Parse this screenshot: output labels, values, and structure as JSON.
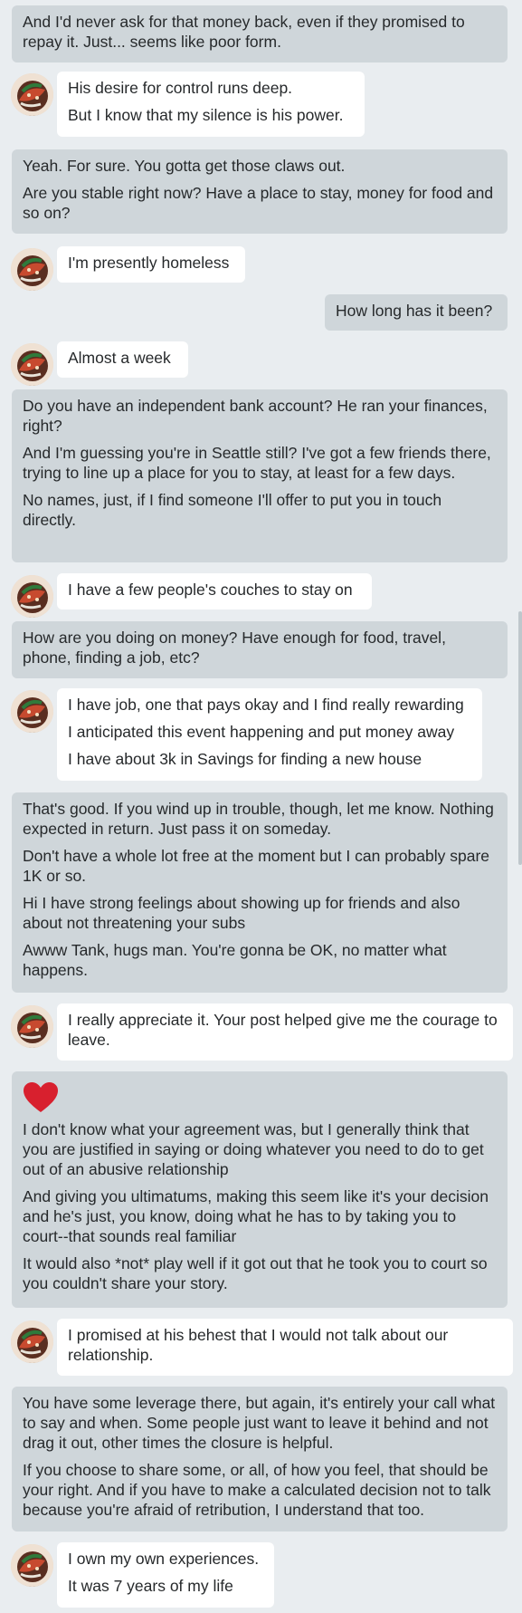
{
  "messages": [
    {
      "side": "sent",
      "lines": [
        "And I'd never ask for that money back, even if they promised to repay it. Just... seems like poor form."
      ]
    },
    {
      "side": "recv",
      "lines": [
        "His desire for control runs deep.",
        "But I know that my silence is his power."
      ]
    },
    {
      "side": "sent",
      "lines": [
        "Yeah. For sure. You gotta get those claws out.",
        "Are you stable right now? Have a place to stay, money for food and so on?"
      ]
    },
    {
      "side": "recv",
      "lines": [
        "I'm presently homeless"
      ]
    },
    {
      "side": "sent",
      "lines": [
        "How long has it been?"
      ]
    },
    {
      "side": "recv",
      "lines": [
        "Almost a week"
      ]
    },
    {
      "side": "sent",
      "lines": [
        "Do you have an independent bank account? He ran your finances, right?",
        "And I'm guessing you're in Seattle still? I've got a few friends there, trying to line up a place for you to stay, at least for a few days.",
        "No names, just, if I find someone I'll offer to put you in touch directly."
      ]
    },
    {
      "side": "recv",
      "lines": [
        "I have a few people's couches to stay on"
      ]
    },
    {
      "side": "sent",
      "lines": [
        "How are you doing on money? Have enough for food, travel, phone, finding a job, etc?"
      ]
    },
    {
      "side": "recv",
      "lines": [
        "I have job, one that pays okay and I find really rewarding",
        "I anticipated this event happening and put money away",
        "I have about 3k in Savings for finding a new house"
      ]
    },
    {
      "side": "sent",
      "lines": [
        "That's good. If you wind up in trouble, though, let me know. Nothing expected in return. Just pass it on someday.",
        "Don't have a whole lot free at the moment but I can probably spare 1K or so.",
        "Hi I have strong feelings about showing up for friends and also about not threatening your subs",
        "Awww Tank, hugs man. You're gonna be OK, no matter what happens."
      ]
    },
    {
      "side": "recv",
      "lines": [
        "I really appreciate it. Your post helped give me the courage to leave."
      ]
    },
    {
      "side": "sent",
      "icon": "red-heart-icon",
      "lines": [
        "I don't know what your agreement was, but I generally think that you are justified in saying or doing whatever you need to do to get out of an abusive relationship",
        "And giving you ultimatums, making this seem like it's your decision and he's just, you know, doing what he has to by taking you to court--that sounds real familiar",
        "It would also *not* play well if it got out that he took you to court so you couldn't share your story."
      ]
    },
    {
      "side": "recv",
      "lines": [
        "I promised at his behest that I would not talk about our relationship."
      ]
    },
    {
      "side": "sent",
      "lines": [
        "You have some leverage there, but again, it's entirely your call what to say and when. Some people just want to leave it behind and not drag it out, other times the closure is helpful.",
        "If you choose to share some, or all, of how you feel, that should be your right. And if you have to make a calculated decision not to talk because you're afraid of retribution, I understand that too."
      ]
    },
    {
      "side": "recv",
      "lines": [
        "I own my own experiences.",
        "It was 7 years of my life"
      ]
    }
  ]
}
